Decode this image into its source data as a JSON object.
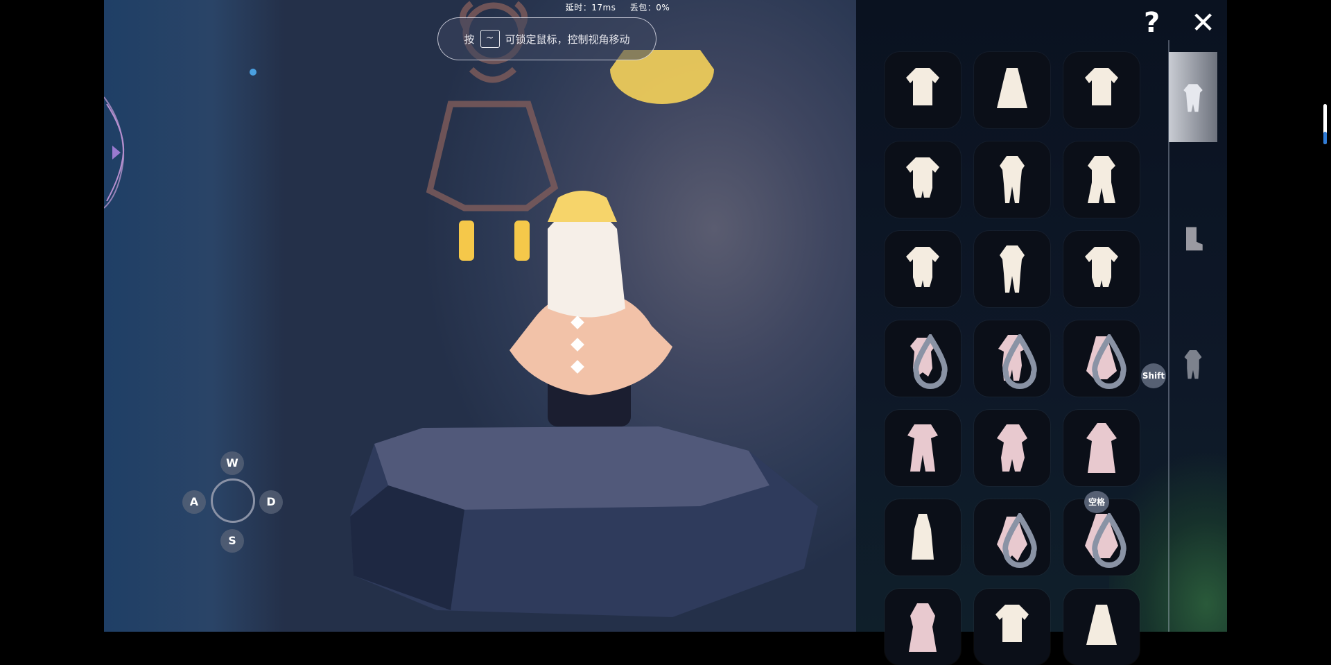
{
  "hud": {
    "latency": "延时：17ms",
    "packet_loss": "丢包：0%",
    "hint_prefix": "按",
    "hint_key": "~",
    "hint_text": "可锁定鼠标，控制视角移动"
  },
  "controls": {
    "up": "W",
    "left": "A",
    "right": "D",
    "down": "S"
  },
  "panel": {
    "help_label": "?",
    "close_label": "✕",
    "shift_label": "Shift",
    "space_label": "空格",
    "categories": [
      {
        "icon": "outfit-icon",
        "active": true
      },
      {
        "icon": "boots-icon",
        "active": false
      },
      {
        "icon": "body-suit-icon",
        "active": false
      }
    ],
    "outfits": [
      {
        "icon": "tunic-outfit-icon",
        "tint": "#f4ece0",
        "dye": false
      },
      {
        "icon": "dress-outfit-icon",
        "tint": "#f4ece0",
        "dye": false
      },
      {
        "icon": "tunic-outfit-icon",
        "tint": "#f4ece0",
        "dye": false
      },
      {
        "icon": "shorts-outfit-icon",
        "tint": "#f4ece0",
        "dye": false
      },
      {
        "icon": "pants-outfit-icon",
        "tint": "#f4ece0",
        "dye": false
      },
      {
        "icon": "wide-pants-outfit-icon",
        "tint": "#f4ece0",
        "dye": false
      },
      {
        "icon": "shorts-outfit-icon",
        "tint": "#f4ece0",
        "dye": false
      },
      {
        "icon": "pants-outfit-icon",
        "tint": "#f4ece0",
        "dye": false
      },
      {
        "icon": "shorts-outfit-icon",
        "tint": "#f4ece0",
        "dye": false
      },
      {
        "icon": "romper-outfit-icon",
        "tint": "#e8c9cf",
        "dye": true
      },
      {
        "icon": "robe-outfit-icon",
        "tint": "#e8c9cf",
        "dye": true
      },
      {
        "icon": "sailor-dress-outfit-icon",
        "tint": "#e8c9cf",
        "dye": true
      },
      {
        "icon": "warrior-outfit-icon",
        "tint": "#e8c9cf",
        "dye": false
      },
      {
        "icon": "martial-outfit-icon",
        "tint": "#e8c9cf",
        "dye": false
      },
      {
        "icon": "hanfu-outfit-icon",
        "tint": "#e8c9cf",
        "dye": false
      },
      {
        "icon": "long-dress-outfit-icon",
        "tint": "#f4ece0",
        "dye": false
      },
      {
        "icon": "frilly-outfit-icon",
        "tint": "#e8c9cf",
        "dye": true
      },
      {
        "icon": "flower-dress-outfit-icon",
        "tint": "#e8c9cf",
        "dye": true
      },
      {
        "icon": "kimono-outfit-icon",
        "tint": "#e8c9cf",
        "dye": false
      },
      {
        "icon": "tunic-outfit-icon",
        "tint": "#f4ece0",
        "dye": false
      },
      {
        "icon": "dress-outfit-icon",
        "tint": "#f4ece0",
        "dye": false
      }
    ]
  },
  "colors": {
    "character_cape": "#f2c2a8",
    "character_bow": "#f6d46a",
    "candle_glow": "#f5c84a",
    "wall_mural": "#7b5a5a"
  }
}
